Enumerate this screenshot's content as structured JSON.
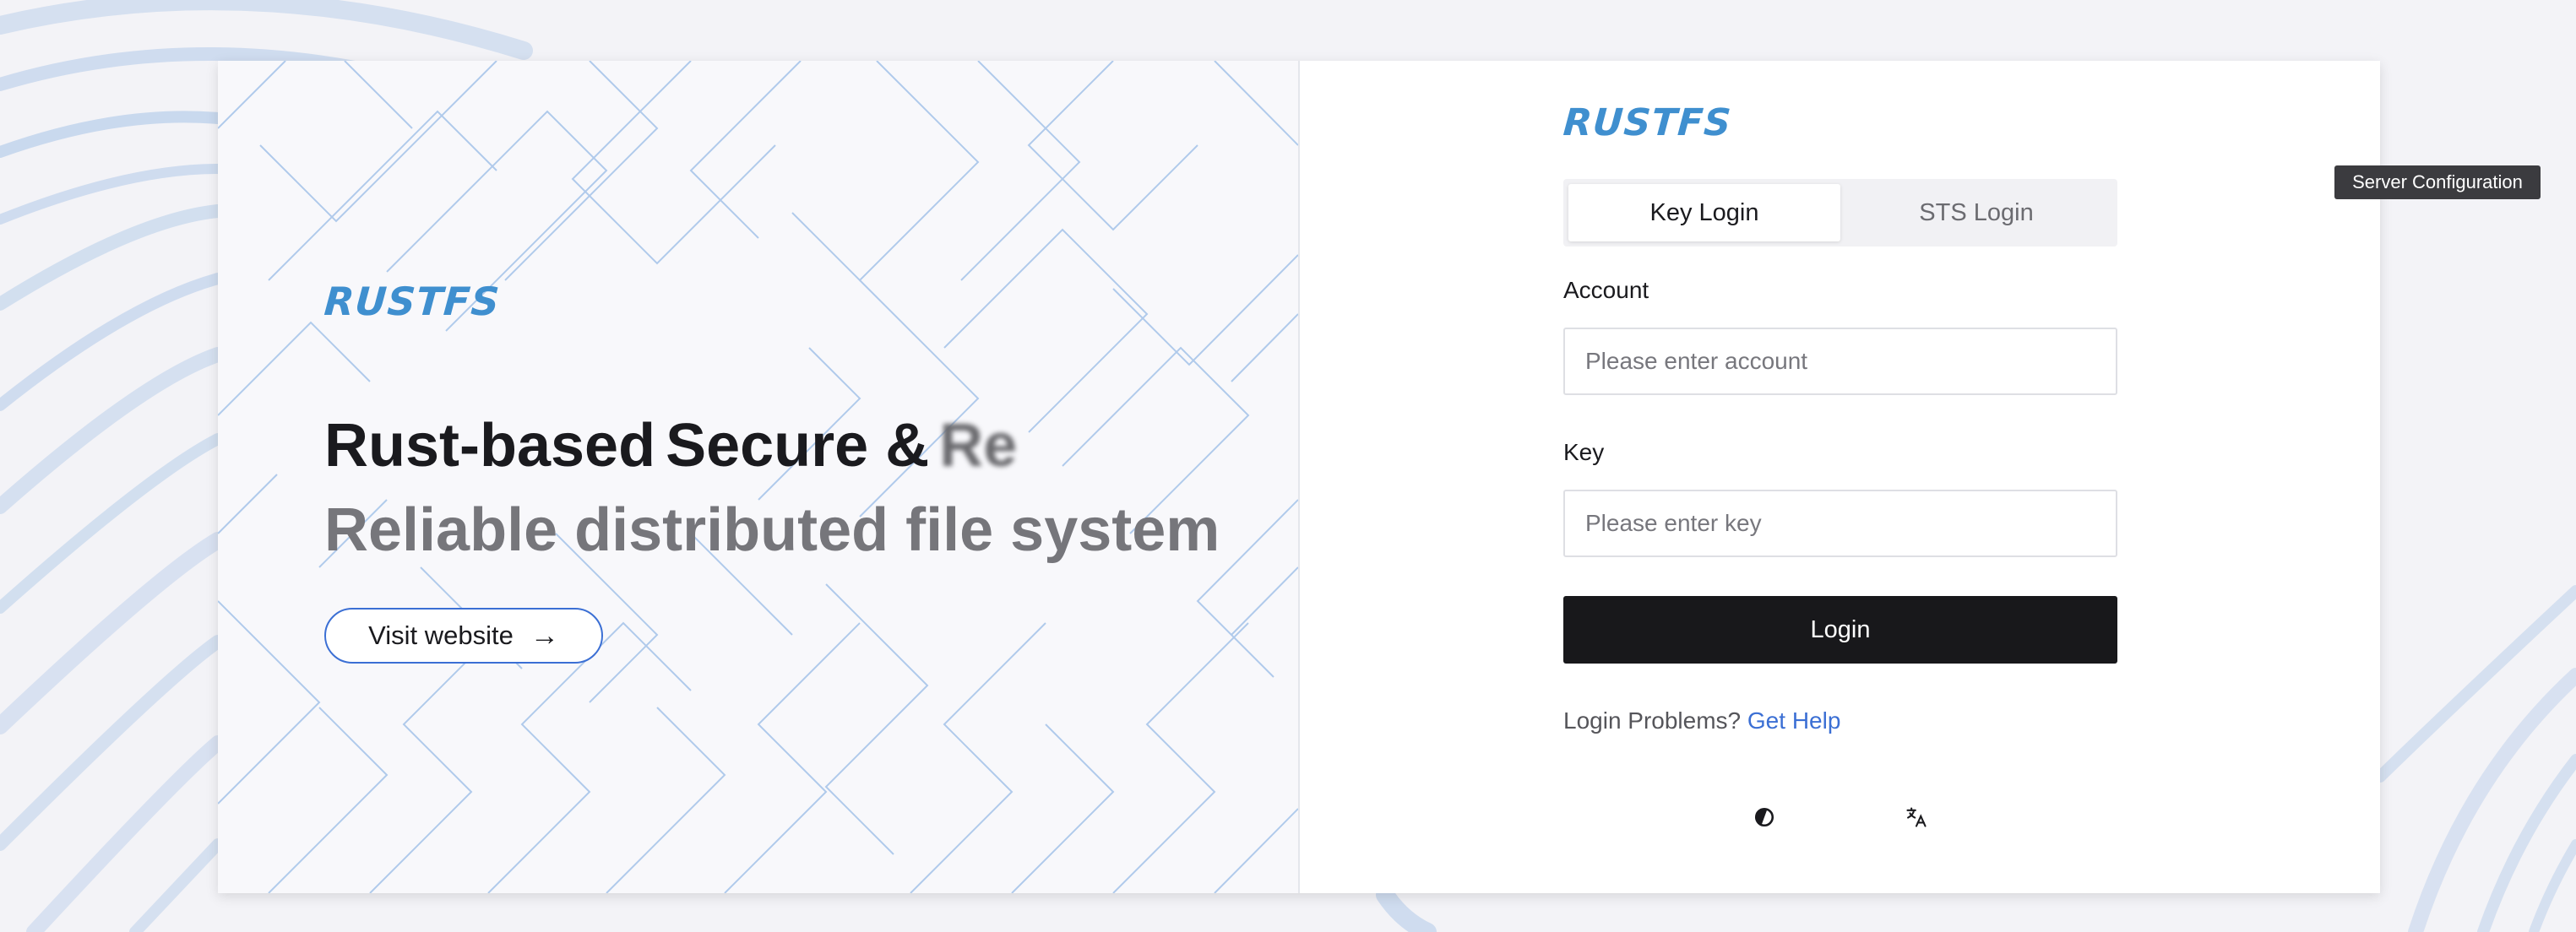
{
  "brand": {
    "name": "RUSTFS",
    "color": "#3f8fcf"
  },
  "hero": {
    "headline_word1": "Rust-based",
    "headline_word2": "Secure &",
    "headline_fading": "Re",
    "subheadline": "Reliable distributed file system",
    "visit_label": "Visit website",
    "visit_arrow": "→"
  },
  "login": {
    "tabs": [
      {
        "label": "Key Login",
        "active": true
      },
      {
        "label": "STS Login",
        "active": false
      }
    ],
    "account_label": "Account",
    "account_placeholder": "Please enter account",
    "account_value": "",
    "key_label": "Key",
    "key_placeholder": "Please enter key",
    "key_value": "",
    "submit_label": "Login",
    "help_text": "Login Problems?",
    "help_link": "Get Help"
  },
  "toolbar": {
    "settings_icon": "gear-icon",
    "settings_tooltip": "Server Configuration",
    "theme_icon": "theme-toggle-icon",
    "language_icon": "translate-icon"
  },
  "colors": {
    "accent": "#3b6fd4",
    "button_dark": "#18181b",
    "background": "#f3f3f7"
  }
}
